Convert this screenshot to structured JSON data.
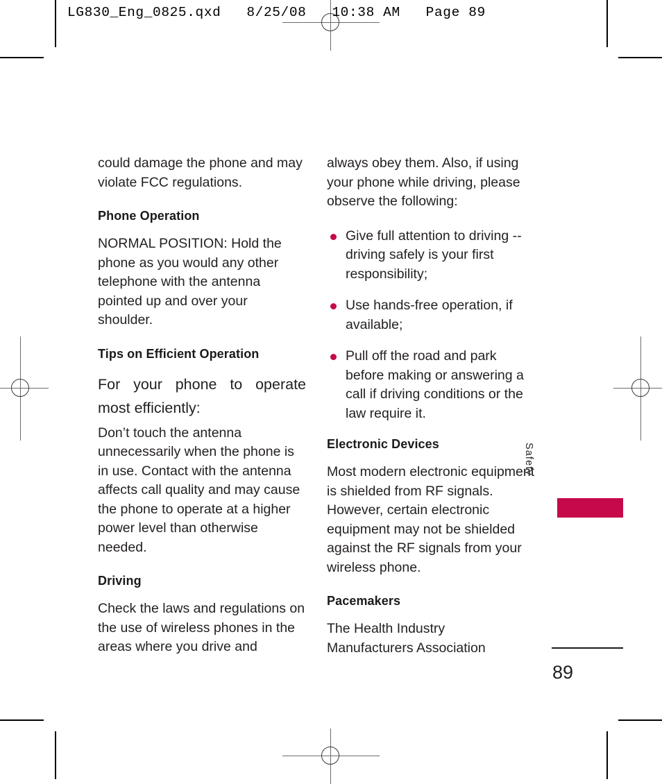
{
  "document": {
    "slug": "LG830_Eng_0825.qxd   8/25/08   10:38 AM   Page 89",
    "folio": "89",
    "section_tab": "Safety",
    "accent_color": "#c6094a"
  },
  "left_column": {
    "blocks": [
      {
        "type": "paragraph",
        "text": "could damage the phone and may violate FCC regulations."
      },
      {
        "type": "heading",
        "text": "Phone Operation"
      },
      {
        "type": "paragraph",
        "text": "NORMAL POSITION: Hold the phone as you would any other telephone with the antenna pointed up and over your shoulder."
      },
      {
        "type": "heading",
        "text": "Tips on Efficient Operation"
      },
      {
        "type": "lead",
        "text": "For your phone to operate most efficiently:"
      },
      {
        "type": "paragraph",
        "text": "Don’t touch the antenna unnecessarily when the phone is in use. Contact with the antenna affects call quality and may cause the phone to operate at a higher power level than otherwise needed."
      },
      {
        "type": "heading",
        "text": "Driving"
      },
      {
        "type": "paragraph",
        "text": "Check the laws and regulations on the use of wireless phones in the areas where you drive and"
      }
    ]
  },
  "right_column": {
    "intro": "always obey them. Also, if using your phone while driving, please observe the following:",
    "bullets": [
      "Give full attention to driving -- driving safely is your first responsibility;",
      "Use hands-free operation, if available;",
      "Pull off the road and park before making or answering a call if driving conditions or the law require it."
    ],
    "electronic_devices": {
      "heading": "Electronic Devices",
      "body": "Most modern electronic equipment is shielded from RF signals. However, certain electronic equipment may not be shielded against the RF signals from your wireless phone."
    },
    "pacemakers": {
      "heading": "Pacemakers",
      "body": "The Health Industry Manufacturers Association"
    }
  }
}
